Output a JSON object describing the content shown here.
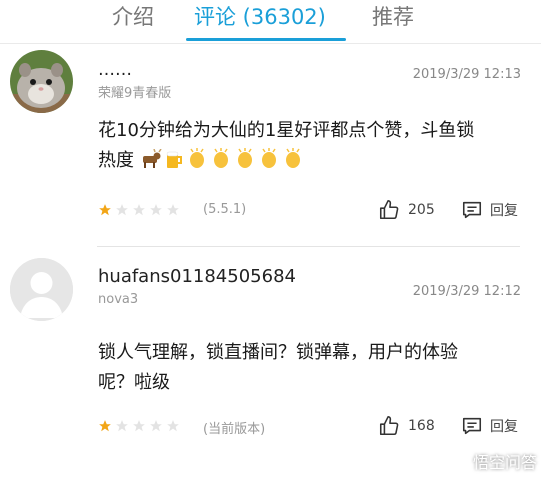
{
  "tabs": [
    {
      "label": "介绍",
      "active": false
    },
    {
      "label": "评论 (36302)",
      "active": true
    },
    {
      "label": "推荐",
      "active": false
    }
  ],
  "accent_color": "#1a9fd8",
  "comments": [
    {
      "username": "……",
      "device": "荣耀9青春版",
      "time": "2019/3/29 12:13",
      "text_line1": "花10分钟给为大仙的1星好评都点个赞，斗鱼锁",
      "text_line2": "热度",
      "emojis": [
        "ox-icon",
        "beer-icon",
        "clap-icon",
        "clap-icon",
        "clap-icon",
        "clap-icon",
        "clap-icon"
      ],
      "rating": 1,
      "max_rating": 5,
      "version": "(5.5.1)",
      "likes": "205",
      "reply_label": "回复"
    },
    {
      "username": "huafans01184505684",
      "device": "nova3",
      "time": "2019/3/29 12:12",
      "text_line1": "锁人气理解，锁直播间？锁弹幕，用户的体验",
      "text_line2": "呢？啦级",
      "rating": 1,
      "max_rating": 5,
      "version": "(当前版本)",
      "likes": "168",
      "reply_label": "回复"
    }
  ],
  "watermark": "悟空问答"
}
